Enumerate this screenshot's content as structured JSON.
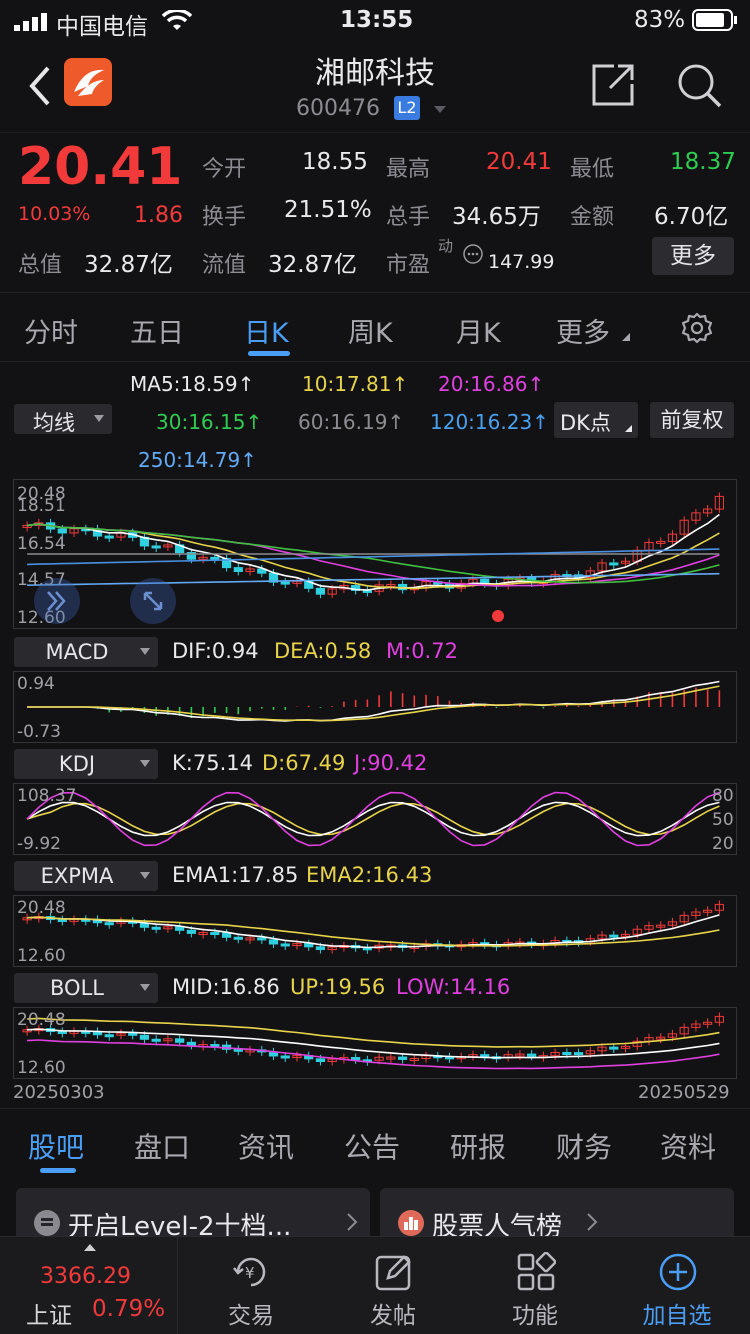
{
  "status_bar": {
    "carrier": "中国电信",
    "time": "13:55",
    "battery": "83%"
  },
  "header": {
    "title": "湘邮科技",
    "code": "600476",
    "level_badge": "L2"
  },
  "quote": {
    "price": "20.41",
    "pct_change": "10.03%",
    "change": "1.86",
    "open_label": "今开",
    "open": "18.55",
    "high_label": "最高",
    "high": "20.41",
    "low_label": "最低",
    "low": "18.37",
    "turnover_label": "换手",
    "turnover": "21.51%",
    "volume_label": "总手",
    "volume": "34.65万",
    "amount_label": "金额",
    "amount": "6.70亿",
    "total_cap_label": "总值",
    "total_cap": "32.87亿",
    "float_cap_label": "流值",
    "float_cap": "32.87亿",
    "pe_label": "市盈",
    "pe_sup": "动",
    "pe": "147.99",
    "more_button": "更多"
  },
  "period_tabs": [
    "分时",
    "五日",
    "日K",
    "周K",
    "月K",
    "更多"
  ],
  "active_period": "日K",
  "ma": {
    "ma5": "MA5:18.59↑",
    "ma10": "10:17.81↑",
    "ma20": "20:16.86↑",
    "ma30": "30:16.15↑",
    "ma60": "60:16.19↑",
    "ma120": "120:16.23↑",
    "ma250": "250:14.79↑",
    "indicator_select": "均线",
    "dk_button": "DK点",
    "adjust_button": "前复权"
  },
  "main_chart": {
    "axis_top": "20.48",
    "axis_2": "18.51",
    "axis_3": "16.54",
    "axis_4": "14.57",
    "axis_bottom": "12.60"
  },
  "macd": {
    "select": "MACD",
    "dif": "DIF:0.94",
    "dea": "DEA:0.58",
    "m": "M:0.72",
    "axis_top": "0.94",
    "axis_bottom": "-0.73"
  },
  "kdj": {
    "select": "KDJ",
    "k": "K:75.14",
    "d": "D:67.49",
    "j": "J:90.42",
    "axis_top": "108.37",
    "axis_bottom": "-9.92",
    "r80": "80",
    "r50": "50",
    "r20": "20"
  },
  "expma": {
    "select": "EXPMA",
    "ema1": "EMA1:17.85",
    "ema2": "EMA2:16.43",
    "axis_top": "20.48",
    "axis_bottom": "12.60"
  },
  "boll": {
    "select": "BOLL",
    "mid": "MID:16.86",
    "up": "UP:19.56",
    "low": "LOW:14.16",
    "axis_top": "20.48",
    "axis_bottom": "12.60"
  },
  "date_range": {
    "start": "20250303",
    "end": "20250529"
  },
  "bottom_tabs": [
    "股吧",
    "盘口",
    "资讯",
    "公告",
    "研报",
    "财务",
    "资料"
  ],
  "active_bottom_tab": "股吧",
  "promo": {
    "left": "开启Level-2十档...",
    "right": "股票人气榜"
  },
  "index": {
    "value": "3366.29",
    "name": "上证",
    "pct": "0.79%"
  },
  "dock": [
    "交易",
    "发帖",
    "功能",
    "加自选"
  ],
  "colors": {
    "up": "#f23a3a",
    "down": "#2fcc52",
    "accent": "#4a9ef5",
    "bg": "#121214"
  }
}
